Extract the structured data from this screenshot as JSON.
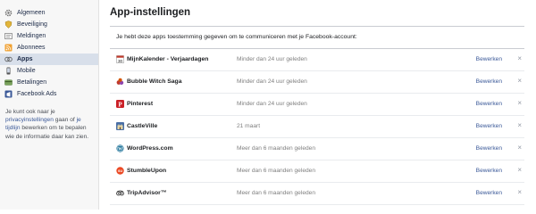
{
  "sidebar": {
    "items": [
      {
        "label": "Algemeen",
        "icon": "gear-icon",
        "active": false
      },
      {
        "label": "Beveiliging",
        "icon": "shield-icon",
        "active": false
      },
      {
        "label": "Meldingen",
        "icon": "notifications-icon",
        "active": false
      },
      {
        "label": "Abonnees",
        "icon": "rss-icon",
        "active": false
      },
      {
        "label": "Apps",
        "icon": "apps-icon",
        "active": true
      },
      {
        "label": "Mobile",
        "icon": "mobile-icon",
        "active": false
      },
      {
        "label": "Betalingen",
        "icon": "payments-icon",
        "active": false
      },
      {
        "label": "Facebook Ads",
        "icon": "ads-icon",
        "active": false
      }
    ],
    "note": {
      "t1": "Je kunt ook naar je",
      "link1": "privacyinstellingen",
      "t2": " gaan of ",
      "link2": "je tijdlijn",
      "t3": " bewerken om te bepalen wie de informatie daar kan zien."
    }
  },
  "main": {
    "title": "App-instellingen",
    "intro": "Je hebt deze apps toestemming gegeven om te communiceren met je Facebook-account:",
    "edit_label": "Bewerken",
    "remove_label": "×",
    "apps": [
      {
        "name": "MijnKalender - Verjaardagen",
        "status": "Minder dan 24 uur geleden",
        "icon": "calendar-icon",
        "icon_text": "30"
      },
      {
        "name": "Bubble Witch Saga",
        "status": "Minder dan 24 uur geleden",
        "icon": "bubble-witch-icon"
      },
      {
        "name": "Pinterest",
        "status": "Minder dan 24 uur geleden",
        "icon": "pinterest-icon",
        "icon_text": "P"
      },
      {
        "name": "CastleVille",
        "status": "21 maart",
        "icon": "castleville-icon"
      },
      {
        "name": "WordPress.com",
        "status": "Meer dan 6 maanden geleden",
        "icon": "wordpress-icon",
        "icon_text": "W"
      },
      {
        "name": "StumbleUpon",
        "status": "Meer dan 6 maanden geleden",
        "icon": "stumbleupon-icon",
        "icon_text": "su"
      },
      {
        "name": "TripAdvisor™",
        "status": "Meer dan 6 maanden geleden",
        "icon": "tripadvisor-icon"
      }
    ]
  },
  "colors": {
    "link": "#3b5998",
    "active_bg": "#d8dfea",
    "sidebar_bg": "#f7f7f7"
  }
}
